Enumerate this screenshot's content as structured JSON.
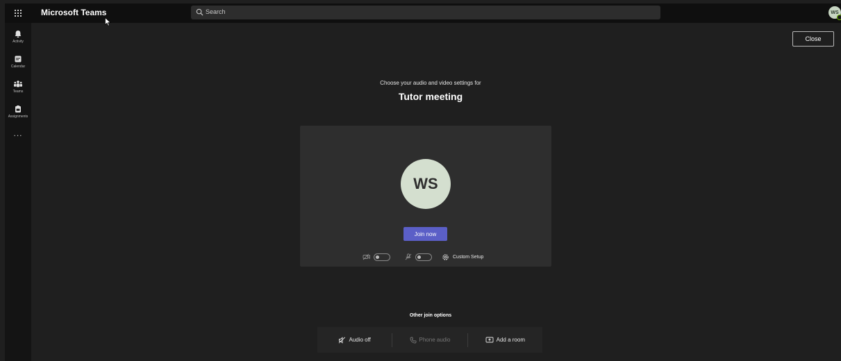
{
  "app": {
    "title": "Microsoft Teams"
  },
  "search": {
    "placeholder": "Search"
  },
  "user": {
    "initials": "WS"
  },
  "rail": {
    "items": [
      {
        "label": "Activity",
        "icon": "bell-icon"
      },
      {
        "label": "Calendar",
        "icon": "calendar-icon"
      },
      {
        "label": "Teams",
        "icon": "teams-icon"
      },
      {
        "label": "Assignments",
        "icon": "assignments-icon"
      }
    ],
    "more": "..."
  },
  "prejoin": {
    "close_label": "Close",
    "subtitle": "Choose your audio and video settings for",
    "meeting_title": "Tutor meeting",
    "avatar_initials": "WS",
    "join_label": "Join now",
    "custom_setup_label": "Custom Setup",
    "camera_on": false,
    "mic_on": false
  },
  "other_options": {
    "title": "Other join options",
    "items": [
      {
        "label": "Audio off",
        "icon": "speaker-off-icon",
        "enabled": true
      },
      {
        "label": "Phone audio",
        "icon": "phone-icon",
        "enabled": false
      },
      {
        "label": "Add a room",
        "icon": "cast-icon",
        "enabled": true
      }
    ]
  },
  "colors": {
    "accent": "#5b5fc7",
    "background": "#1f1f1f",
    "preview_bg": "#2e2e2e",
    "avatar_bg": "#d4dfcf"
  }
}
